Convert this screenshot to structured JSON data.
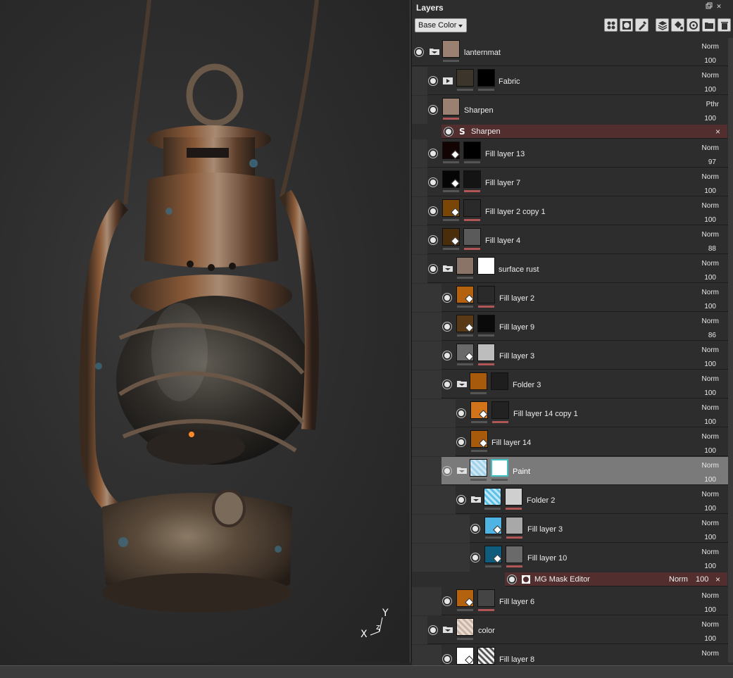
{
  "panel": {
    "title": "Layers",
    "channel": "Base Color"
  },
  "axes": {
    "y": "Y",
    "z": "z",
    "x": "X"
  },
  "icons": {
    "header": [
      "float-icon",
      "close-icon"
    ],
    "toolbar": [
      "add-effect-icon",
      "add-mask-icon",
      "paint-icon",
      "add-layer-icon",
      "add-fill-icon",
      "smart-material-icon",
      "add-folder-icon",
      "delete-icon"
    ]
  },
  "layers": [
    {
      "name": "lanternmat",
      "blend": "Norm",
      "opacity": "100"
    },
    {
      "name": "Fabric",
      "blend": "Norm",
      "opacity": "100"
    },
    {
      "name": "Sharpen",
      "blend": "Pthr",
      "opacity": "100"
    },
    {
      "name": "Fill layer 13",
      "blend": "Norm",
      "opacity": "97"
    },
    {
      "name": "Fill layer 7",
      "blend": "Norm",
      "opacity": "100"
    },
    {
      "name": "Fill layer 2 copy 1",
      "blend": "Norm",
      "opacity": "100"
    },
    {
      "name": "Fill layer 4",
      "blend": "Norm",
      "opacity": "88"
    },
    {
      "name": "surface rust",
      "blend": "Norm",
      "opacity": "100"
    },
    {
      "name": "Fill layer 2",
      "blend": "Norm",
      "opacity": "100"
    },
    {
      "name": "Fill layer 9",
      "blend": "Norm",
      "opacity": "86"
    },
    {
      "name": "Fill layer 3",
      "blend": "Norm",
      "opacity": "100"
    },
    {
      "name": "Folder 3",
      "blend": "Norm",
      "opacity": "100"
    },
    {
      "name": "Fill layer 14 copy 1",
      "blend": "Norm",
      "opacity": "100"
    },
    {
      "name": "Fill layer 14",
      "blend": "Norm",
      "opacity": "100"
    },
    {
      "name": "Paint",
      "blend": "Norm",
      "opacity": "100"
    },
    {
      "name": "Folder 2",
      "blend": "Norm",
      "opacity": "100"
    },
    {
      "name": "Fill layer 3",
      "blend": "Norm",
      "opacity": "100"
    },
    {
      "name": "Fill layer 10",
      "blend": "Norm",
      "opacity": "100"
    },
    {
      "name": "Fill layer 6",
      "blend": "Norm",
      "opacity": "100"
    },
    {
      "name": "color",
      "blend": "Norm",
      "opacity": "100"
    },
    {
      "name": "Fill layer 8",
      "blend": "Norm",
      "opacity": ""
    }
  ],
  "effects": [
    {
      "name": "Sharpen",
      "close": "×"
    },
    {
      "name": "MG Mask Editor",
      "blend": "Norm",
      "opacity": "100",
      "close": "×"
    }
  ],
  "colors": {
    "selected_row": "#7a7a7a",
    "effect_row": "#532e2f",
    "rust_orange": "#b5620f",
    "paint_blue": "#4fb4e4"
  }
}
